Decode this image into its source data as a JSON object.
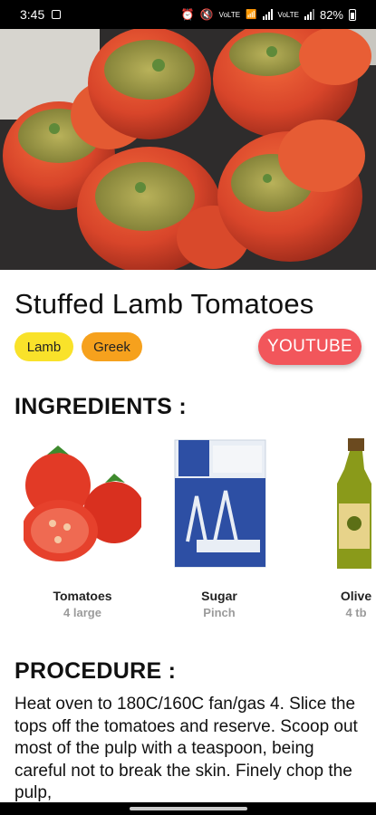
{
  "status_bar": {
    "time": "3:45",
    "battery": "82%",
    "icons": [
      "image-icon",
      "alarm-icon",
      "mute-icon",
      "volte-icon",
      "wifi-icon",
      "signal-icon",
      "signal-icon",
      "battery-icon"
    ]
  },
  "recipe": {
    "hero_image": "stuffed-tomatoes-photo",
    "title": "Stuffed Lamb Tomatoes",
    "tags": [
      "Lamb",
      "Greek"
    ],
    "youtube_label": "YOUTUBE"
  },
  "ingredients": {
    "title": "INGREDIENTS :",
    "items": [
      {
        "name": "Tomatoes",
        "qty": "4 large"
      },
      {
        "name": "Sugar",
        "qty": "Pinch"
      },
      {
        "name": "Olive",
        "qty": "4 tb"
      }
    ]
  },
  "procedure": {
    "title": "PROCEDURE :",
    "text": "Heat oven to 180C/160C fan/gas 4. Slice the tops off the tomatoes and reserve. Scoop out most of the pulp with a teaspoon, being careful not to break the skin. Finely chop the pulp,"
  },
  "colors": {
    "tag_lamb": "#f9e22a",
    "tag_greek": "#f6a11d",
    "youtube": "#f2565b"
  }
}
